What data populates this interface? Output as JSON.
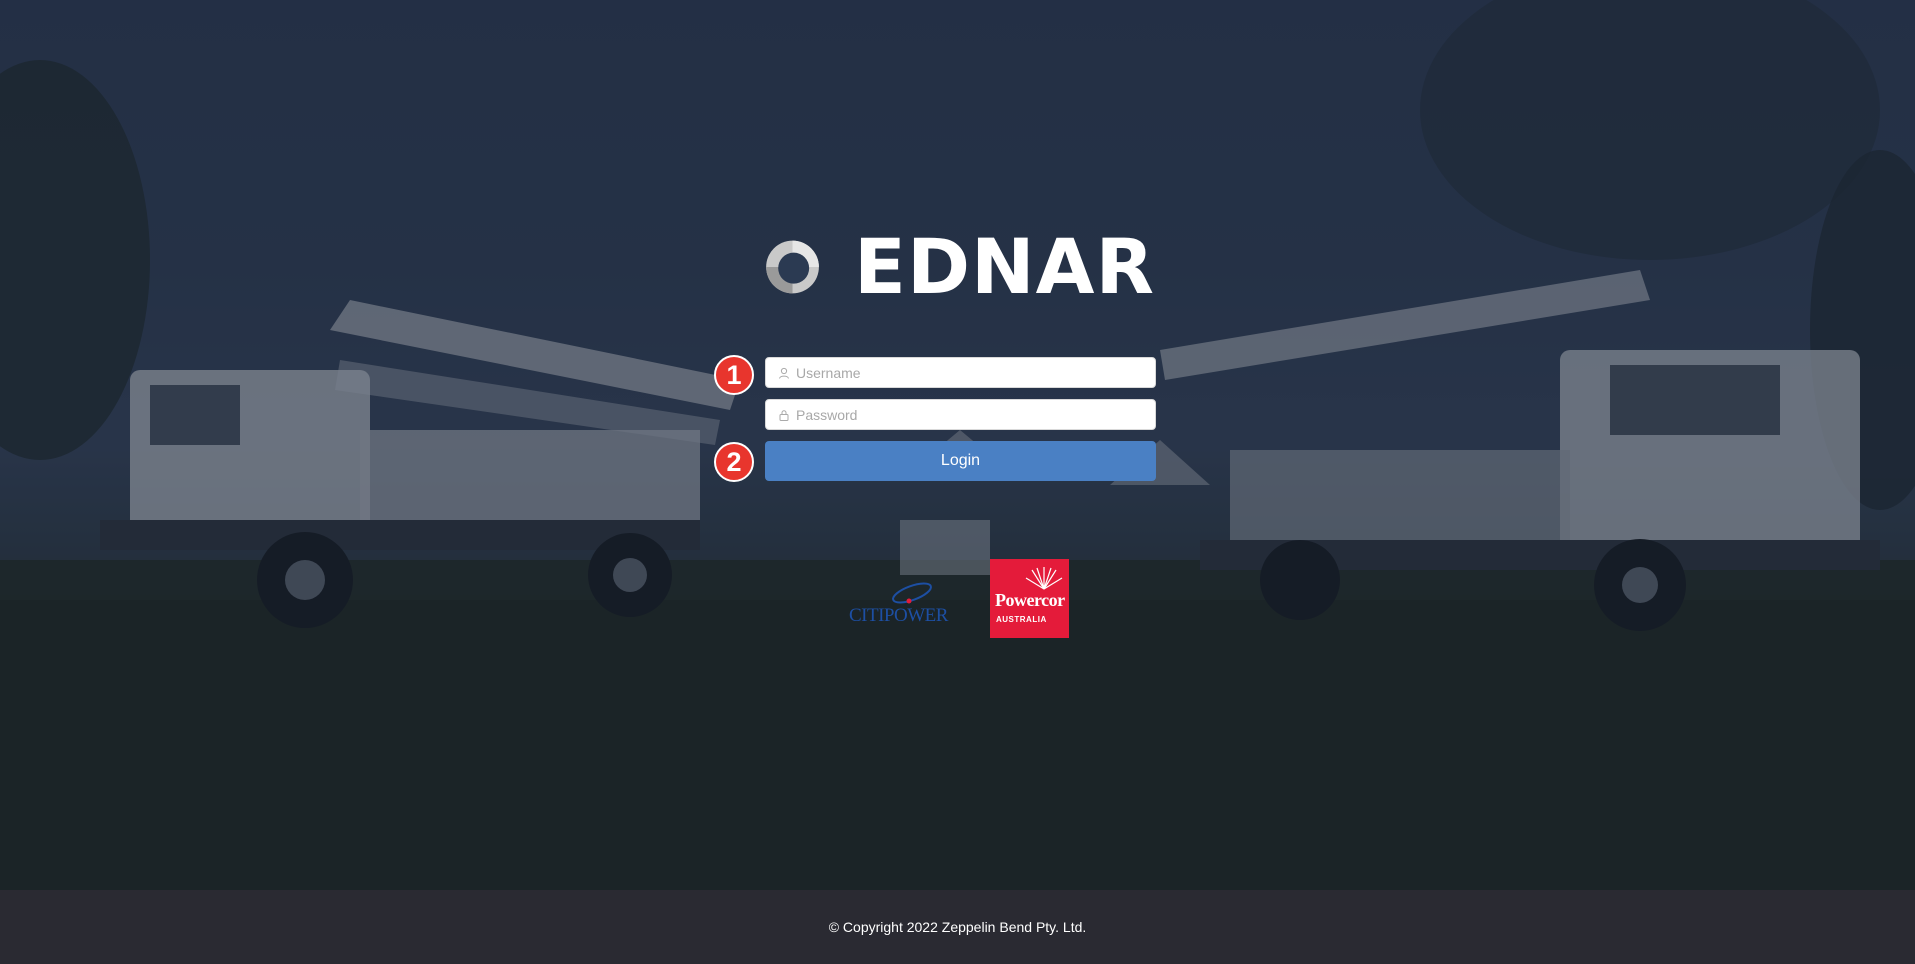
{
  "brand": {
    "name": "EDNAR",
    "logo_icon": "ring-logo-icon"
  },
  "login_form": {
    "username_placeholder": "Username",
    "username_icon": "user-icon",
    "password_placeholder": "Password",
    "password_icon": "lock-icon",
    "login_label": "Login",
    "accent_color": "#4a80c4"
  },
  "annotations": {
    "step_1": "1",
    "step_2": "2",
    "badge_color": "#e8352d"
  },
  "partners": {
    "citipower": "CITIPOWER",
    "powercor_name": "Powercor",
    "powercor_sub": "AUSTRALIA",
    "powercor_color": "#e41b3a"
  },
  "footer": {
    "copyright": "© Copyright 2022 Zeppelin Bend Pty. Ltd."
  }
}
